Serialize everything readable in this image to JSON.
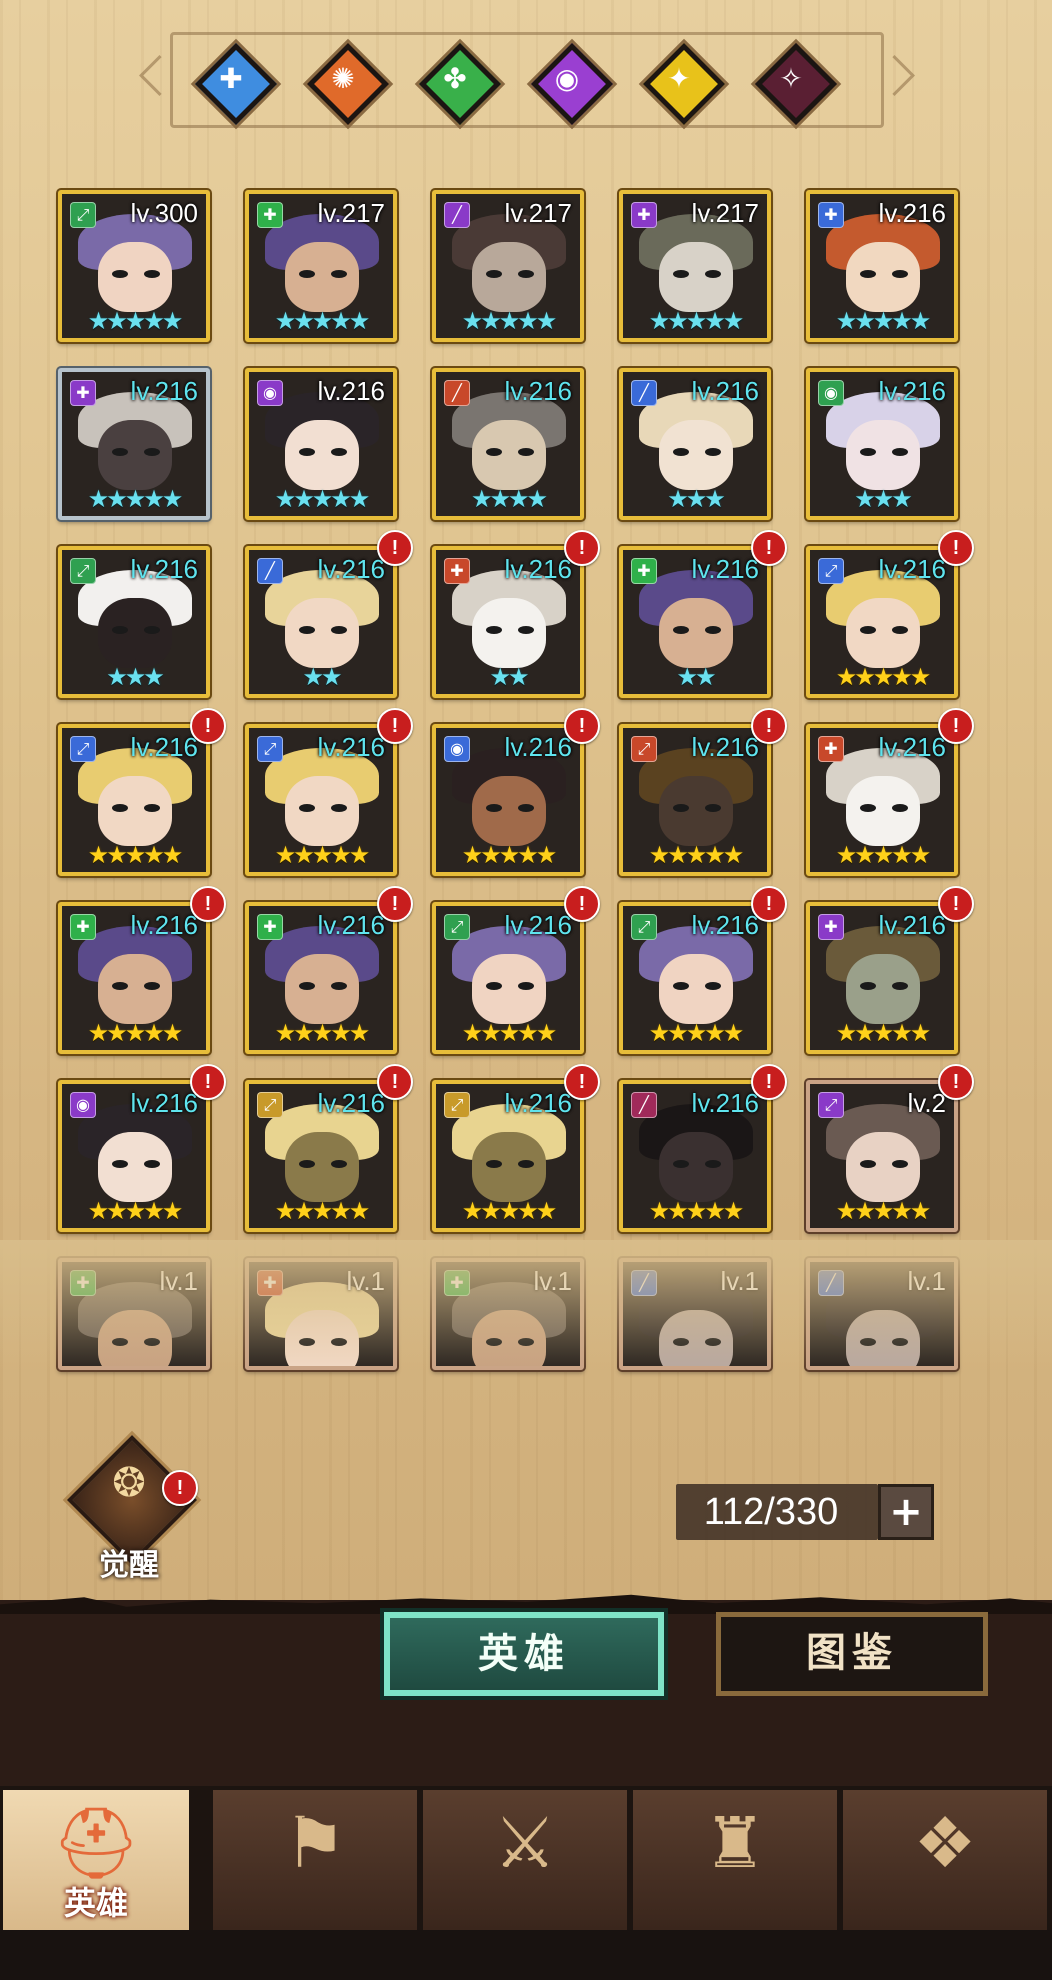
{
  "factions": [
    {
      "name": "faction-light",
      "color": "#3f8de0",
      "icon": "ankh-icon",
      "glyph": "✚"
    },
    {
      "name": "faction-fire",
      "color": "#e06a2a",
      "icon": "sun-gear-icon",
      "glyph": "✺"
    },
    {
      "name": "faction-nature",
      "color": "#39b04a",
      "icon": "clover-icon",
      "glyph": "✤"
    },
    {
      "name": "faction-arcane",
      "color": "#9a3fd1",
      "icon": "eye-icon",
      "glyph": "◉"
    },
    {
      "name": "faction-holy",
      "color": "#e8c21a",
      "icon": "radiant-eye-icon",
      "glyph": "✦"
    },
    {
      "name": "faction-dark",
      "color": "#5a1f33",
      "icon": "dark-sigil-icon",
      "glyph": "✧"
    }
  ],
  "heroes": [
    {
      "level": "lv.300",
      "stars": "★★★★★",
      "star_color": "cyan",
      "cls_color": "#2fa050",
      "cls_glyph": "⤢",
      "alert": false,
      "frame": "gold",
      "hair": "#7a6aa8",
      "face": "#f0d4c2",
      "level_color": "white"
    },
    {
      "level": "lv.217",
      "stars": "★★★★★",
      "star_color": "cyan",
      "cls_color": "#2fb04a",
      "cls_glyph": "✚",
      "alert": false,
      "frame": "gold",
      "hair": "#5a4a8a",
      "face": "#d7b092",
      "level_color": "white"
    },
    {
      "level": "lv.217",
      "stars": "★★★★★",
      "star_color": "cyan",
      "cls_color": "#8a3ac8",
      "cls_glyph": "╱",
      "alert": false,
      "frame": "gold",
      "hair": "#4a3a36",
      "face": "#b8a89a",
      "level_color": "white"
    },
    {
      "level": "lv.217",
      "stars": "★★★★★",
      "star_color": "cyan",
      "cls_color": "#8a3ac8",
      "cls_glyph": "✚",
      "alert": false,
      "frame": "gold",
      "hair": "#6a6a5a",
      "face": "#d8d2c8",
      "level_color": "white"
    },
    {
      "level": "lv.216",
      "stars": "★★★★★",
      "star_color": "cyan",
      "cls_color": "#3a6ad8",
      "cls_glyph": "✚",
      "alert": false,
      "frame": "gold",
      "hair": "#c45a2e",
      "face": "#f1d8c0",
      "level_color": "white"
    },
    {
      "level": "lv.216",
      "stars": "★★★★★",
      "star_color": "cyan",
      "cls_color": "#8a3ac8",
      "cls_glyph": "✚",
      "alert": false,
      "frame": "silver",
      "hair": "#c8c2bb",
      "face": "#4a4040",
      "level_color": "cyan"
    },
    {
      "level": "lv.216",
      "stars": "★★★★★",
      "star_color": "cyan",
      "cls_color": "#8a3ac8",
      "cls_glyph": "◉",
      "alert": false,
      "frame": "gold",
      "hair": "#2a2428",
      "face": "#f2dfd2",
      "level_color": "white"
    },
    {
      "level": "lv.216",
      "stars": "★★★★",
      "star_color": "cyan",
      "cls_color": "#c8482a",
      "cls_glyph": "╱",
      "alert": false,
      "frame": "gold",
      "hair": "#7a7570",
      "face": "#d8c8b0",
      "level_color": "cyan"
    },
    {
      "level": "lv.216",
      "stars": "★★★",
      "star_color": "cyan",
      "cls_color": "#3a6ad8",
      "cls_glyph": "╱",
      "alert": false,
      "frame": "gold",
      "hair": "#e8d8b8",
      "face": "#f1e2d2",
      "level_color": "cyan"
    },
    {
      "level": "lv.216",
      "stars": "★★★",
      "star_color": "cyan",
      "cls_color": "#2fa050",
      "cls_glyph": "◉",
      "alert": false,
      "frame": "gold",
      "hair": "#d8d2e8",
      "face": "#f0e2e4",
      "level_color": "cyan"
    },
    {
      "level": "lv.216",
      "stars": "★★★",
      "star_color": "cyan",
      "cls_color": "#2fa050",
      "cls_glyph": "⤢",
      "alert": false,
      "frame": "gold",
      "hair": "#f2f0ee",
      "face": "#2a2222",
      "level_color": "cyan"
    },
    {
      "level": "lv.216",
      "stars": "★★",
      "star_color": "cyan",
      "cls_color": "#3a6ad8",
      "cls_glyph": "╱",
      "alert": true,
      "frame": "gold",
      "hair": "#e8d49a",
      "face": "#f1d8c4",
      "level_color": "cyan"
    },
    {
      "level": "lv.216",
      "stars": "★★",
      "star_color": "cyan",
      "cls_color": "#c8482a",
      "cls_glyph": "✚",
      "alert": true,
      "frame": "gold",
      "hair": "#d8d2c8",
      "face": "#f4f2ee",
      "level_color": "cyan"
    },
    {
      "level": "lv.216",
      "stars": "★★",
      "star_color": "cyan",
      "cls_color": "#2fb04a",
      "cls_glyph": "✚",
      "alert": true,
      "frame": "gold",
      "hair": "#5a4a8a",
      "face": "#d7b092",
      "level_color": "cyan"
    },
    {
      "level": "lv.216",
      "stars": "★★★★★",
      "star_color": "gold",
      "cls_color": "#3a6ad8",
      "cls_glyph": "⤢",
      "alert": true,
      "frame": "gold",
      "hair": "#e8cc70",
      "face": "#f1d8c4",
      "level_color": "cyan"
    },
    {
      "level": "lv.216",
      "stars": "★★★★★",
      "star_color": "gold",
      "cls_color": "#3a6ad8",
      "cls_glyph": "⤢",
      "alert": true,
      "frame": "gold",
      "hair": "#e8cc70",
      "face": "#f1d8c4",
      "level_color": "cyan"
    },
    {
      "level": "lv.216",
      "stars": "★★★★★",
      "star_color": "gold",
      "cls_color": "#3a6ad8",
      "cls_glyph": "⤢",
      "alert": true,
      "frame": "gold",
      "hair": "#e8cc70",
      "face": "#f1d8c4",
      "level_color": "cyan"
    },
    {
      "level": "lv.216",
      "stars": "★★★★★",
      "star_color": "gold",
      "cls_color": "#3a6ad8",
      "cls_glyph": "◉",
      "alert": true,
      "frame": "gold",
      "hair": "#2a2020",
      "face": "#a06a4a",
      "level_color": "cyan"
    },
    {
      "level": "lv.216",
      "stars": "★★★★★",
      "star_color": "gold",
      "cls_color": "#c8482a",
      "cls_glyph": "⤢",
      "alert": true,
      "frame": "gold",
      "hair": "#5a4220",
      "face": "#4a3a30",
      "level_color": "cyan"
    },
    {
      "level": "lv.216",
      "stars": "★★★★★",
      "star_color": "gold",
      "cls_color": "#c8482a",
      "cls_glyph": "✚",
      "alert": true,
      "frame": "gold",
      "hair": "#d8d2c8",
      "face": "#f4f2ee",
      "level_color": "cyan"
    },
    {
      "level": "lv.216",
      "stars": "★★★★★",
      "star_color": "gold",
      "cls_color": "#2fb04a",
      "cls_glyph": "✚",
      "alert": true,
      "frame": "gold",
      "hair": "#5a4a8a",
      "face": "#d7b092",
      "level_color": "cyan"
    },
    {
      "level": "lv.216",
      "stars": "★★★★★",
      "star_color": "gold",
      "cls_color": "#2fb04a",
      "cls_glyph": "✚",
      "alert": true,
      "frame": "gold",
      "hair": "#5a4a8a",
      "face": "#d7b092",
      "level_color": "cyan"
    },
    {
      "level": "lv.216",
      "stars": "★★★★★",
      "star_color": "gold",
      "cls_color": "#2fa050",
      "cls_glyph": "⤢",
      "alert": true,
      "frame": "gold",
      "hair": "#7a6aa8",
      "face": "#f0d4c2",
      "level_color": "cyan"
    },
    {
      "level": "lv.216",
      "stars": "★★★★★",
      "star_color": "gold",
      "cls_color": "#2fa050",
      "cls_glyph": "⤢",
      "alert": true,
      "frame": "gold",
      "hair": "#7a6aa8",
      "face": "#f0d4c2",
      "level_color": "cyan"
    },
    {
      "level": "lv.216",
      "stars": "★★★★★",
      "star_color": "gold",
      "cls_color": "#8a3ac8",
      "cls_glyph": "✚",
      "alert": true,
      "frame": "gold",
      "hair": "#6a5a3a",
      "face": "#9aa08a",
      "level_color": "cyan"
    },
    {
      "level": "lv.216",
      "stars": "★★★★★",
      "star_color": "gold",
      "cls_color": "#8a3ac8",
      "cls_glyph": "◉",
      "alert": true,
      "frame": "gold",
      "hair": "#2a2428",
      "face": "#f2dfd2",
      "level_color": "cyan"
    },
    {
      "level": "lv.216",
      "stars": "★★★★★",
      "star_color": "gold",
      "cls_color": "#c89a2a",
      "cls_glyph": "⤢",
      "alert": true,
      "frame": "gold",
      "hair": "#e8d490",
      "face": "#8a7a4a",
      "level_color": "cyan"
    },
    {
      "level": "lv.216",
      "stars": "★★★★★",
      "star_color": "gold",
      "cls_color": "#c89a2a",
      "cls_glyph": "⤢",
      "alert": true,
      "frame": "gold",
      "hair": "#e8d490",
      "face": "#8a7a4a",
      "level_color": "cyan"
    },
    {
      "level": "lv.216",
      "stars": "★★★★★",
      "star_color": "gold",
      "cls_color": "#a02a5a",
      "cls_glyph": "╱",
      "alert": true,
      "frame": "gold",
      "hair": "#1a1616",
      "face": "#3a3030",
      "level_color": "cyan"
    },
    {
      "level": "lv.2",
      "stars": "★★★★★",
      "star_color": "gold",
      "cls_color": "#8a3ac8",
      "cls_glyph": "⤢",
      "alert": true,
      "frame": "bronze",
      "hair": "#6a5a52",
      "face": "#e8d2c4",
      "level_color": "white"
    },
    {
      "level": "lv.1",
      "stars": "",
      "star_color": "gold",
      "cls_color": "#2fb04a",
      "cls_glyph": "✚",
      "alert": false,
      "frame": "bronze",
      "hair": "#6a6058",
      "face": "#c8a282",
      "level_color": "white"
    },
    {
      "level": "lv.1",
      "stars": "",
      "star_color": "gold",
      "cls_color": "#c8482a",
      "cls_glyph": "✚",
      "alert": false,
      "frame": "bronze",
      "hair": "#e8d49a",
      "face": "#f1d8c4",
      "level_color": "white"
    },
    {
      "level": "lv.1",
      "stars": "",
      "star_color": "gold",
      "cls_color": "#2fb04a",
      "cls_glyph": "✚",
      "alert": false,
      "frame": "bronze",
      "hair": "#6a6058",
      "face": "#c8a282",
      "level_color": "white"
    },
    {
      "level": "lv.1",
      "stars": "",
      "star_color": "gold",
      "cls_color": "#3a6ad8",
      "cls_glyph": "╱",
      "alert": false,
      "frame": "bronze",
      "hair": "#2a2424",
      "face": "#b8a8a0",
      "level_color": "white"
    },
    {
      "level": "lv.1",
      "stars": "",
      "star_color": "gold",
      "cls_color": "#3a6ad8",
      "cls_glyph": "╱",
      "alert": false,
      "frame": "bronze",
      "hair": "#2a2424",
      "face": "#b8a8a0",
      "level_color": "white"
    }
  ],
  "alert_glyph": "!",
  "awaken": {
    "label": "觉醒",
    "icon": "awaken-flame-icon",
    "glyph": "❂"
  },
  "capacity": {
    "text": "112/330",
    "plus": "+"
  },
  "tabs": {
    "heroes": "英雄",
    "codex": "图鉴"
  },
  "nav": [
    {
      "name": "nav-heroes",
      "icon": "knight-helmet-icon",
      "glyph": "⛑",
      "label": "英雄",
      "active": true
    },
    {
      "name": "nav-adventure",
      "icon": "compass-flag-icon",
      "glyph": "⚑",
      "label": "",
      "active": false
    },
    {
      "name": "nav-battle",
      "icon": "crossed-swords-icon",
      "glyph": "⚔",
      "label": "",
      "active": false
    },
    {
      "name": "nav-castle",
      "icon": "castle-tower-icon",
      "glyph": "♜",
      "label": "",
      "active": false
    },
    {
      "name": "nav-guild",
      "icon": "handshake-emblem-icon",
      "glyph": "❖",
      "label": "",
      "active": false
    }
  ]
}
